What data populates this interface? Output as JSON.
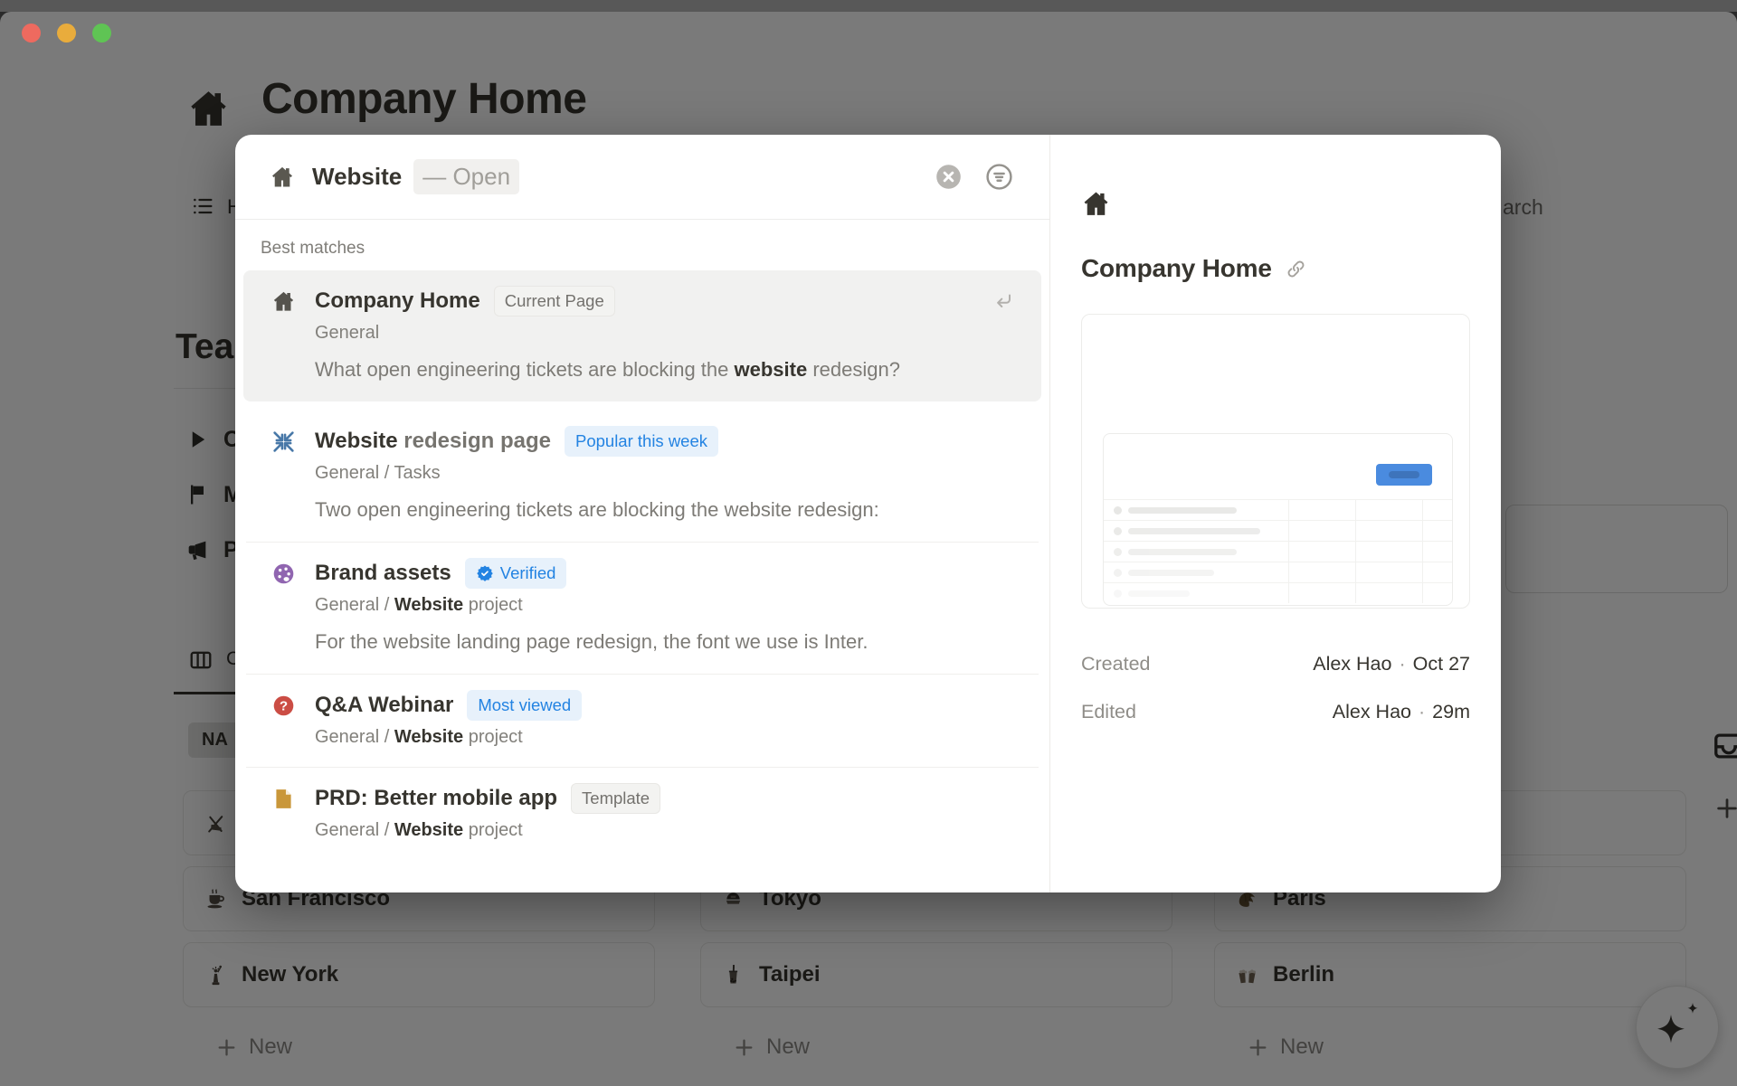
{
  "colors": {
    "accent_blue": "#2383E2",
    "badge_blue_bg": "#E7F1FB",
    "selected_row_bg": "#F1F1F0",
    "icon_purple": "#9065B0",
    "icon_red": "#CB4D44",
    "icon_gold": "#C9973A",
    "icon_steel_blue": "#4878A8",
    "preview_button_blue": "#4A8BDF",
    "traffic_red": "#EE6A5F",
    "traffic_yellow": "#E9AC3C",
    "traffic_green": "#5FC454"
  },
  "window": {
    "traffic_lights": [
      "close",
      "minimize",
      "zoom"
    ]
  },
  "background": {
    "page_icon": "home-icon",
    "page_title": "Company Home",
    "nav_tab": {
      "icon": "toc-icon",
      "label": "H"
    },
    "toolbar_search_text": "arch",
    "section_heading": "Tea",
    "sidebar_items": [
      {
        "icon": "play-icon",
        "label": "C"
      },
      {
        "icon": "flag-icon",
        "label": "M"
      },
      {
        "icon": "megaphone-icon",
        "label": "P"
      }
    ],
    "view_tab": {
      "icon": "board-icon",
      "label": "C"
    },
    "column_header": "NA",
    "board_columns": [
      {
        "cards": [
          {
            "icon": "skis-icon",
            "label": ""
          },
          {
            "icon": "coffee-icon",
            "label": "San Francisco"
          },
          {
            "icon": "statue-icon",
            "label": "New York"
          }
        ],
        "new_label": "New"
      },
      {
        "cards": [
          {
            "icon": "sushi-icon",
            "label": "Tokyo"
          },
          {
            "icon": "bubble-tea-icon",
            "label": "Taipei"
          }
        ],
        "new_label": "New"
      },
      {
        "cards": [
          {
            "icon": "",
            "label": ""
          },
          {
            "icon": "croissant-icon",
            "label": "Paris"
          },
          {
            "icon": "beers-icon",
            "label": "Berlin"
          }
        ],
        "new_label": "New"
      }
    ],
    "ai_button_icon": "sparkle-icon",
    "edge_icons": [
      "inbox-icon",
      "plus-icon"
    ]
  },
  "modal": {
    "search": {
      "icon": "home-icon",
      "query": "Website",
      "suggestion": "— Open"
    },
    "section_label": "Best matches",
    "results": [
      {
        "icon": "home-icon",
        "selected": true,
        "title_parts": [
          {
            "t": "Company Home",
            "b": true
          }
        ],
        "badge": {
          "label": "Current Page",
          "style": "neutral"
        },
        "path_parts": [
          {
            "t": "General",
            "b": false
          }
        ],
        "snippet_parts": [
          {
            "t": "What open engineering tickets are blocking the ",
            "b": false
          },
          {
            "t": "website",
            "b": true
          },
          {
            "t": " redesign?",
            "b": false
          }
        ],
        "snippet_narrow": true,
        "trailing_icon": "return-icon"
      },
      {
        "icon": "compress-icon",
        "selected": false,
        "title_parts": [
          {
            "t": "Website",
            "b": true
          },
          {
            "t": " redesign page",
            "b": false
          }
        ],
        "badge": {
          "label": "Popular this week",
          "style": "blue"
        },
        "path_parts": [
          {
            "t": "General / Tasks",
            "b": false
          }
        ],
        "snippet_parts": [
          {
            "t": "Two open engineering tickets are blocking the website redesign:",
            "b": false
          }
        ]
      },
      {
        "icon": "palette-icon",
        "selected": false,
        "title_parts": [
          {
            "t": "Brand assets",
            "b": true
          }
        ],
        "badge": {
          "label": "Verified",
          "style": "blue",
          "icon": "verified-icon"
        },
        "path_parts": [
          {
            "t": "General / ",
            "b": false
          },
          {
            "t": "Website",
            "b": true
          },
          {
            "t": " project",
            "b": false
          }
        ],
        "snippet_parts": [
          {
            "t": "For the website landing page redesign, the font we use is Inter.",
            "b": false
          }
        ]
      },
      {
        "icon": "question-icon",
        "selected": false,
        "title_parts": [
          {
            "t": "Q&A Webinar",
            "b": true
          }
        ],
        "badge": {
          "label": "Most viewed",
          "style": "blue"
        },
        "path_parts": [
          {
            "t": "General / ",
            "b": false
          },
          {
            "t": "Website",
            "b": true
          },
          {
            "t": " project",
            "b": false
          }
        ]
      },
      {
        "icon": "document-icon",
        "selected": false,
        "title_parts": [
          {
            "t": "PRD: Better mobile app",
            "b": true
          }
        ],
        "badge": {
          "label": "Template",
          "style": "neutral"
        },
        "path_parts": [
          {
            "t": "General / ",
            "b": false
          },
          {
            "t": "Website",
            "b": true
          },
          {
            "t": " project",
            "b": false
          }
        ]
      }
    ],
    "panel": {
      "icon": "home-icon",
      "title": "Company Home",
      "link_icon": "link-icon",
      "separator": "·",
      "created": {
        "label": "Created",
        "person": "Alex Hao",
        "time": "Oct 27"
      },
      "edited": {
        "label": "Edited",
        "person": "Alex Hao",
        "time": "29m"
      }
    }
  }
}
